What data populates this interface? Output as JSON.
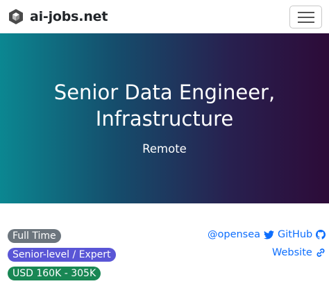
{
  "navbar": {
    "brand": "ai-jobs.net",
    "logo_icon": "hexagon-cube-logo-icon",
    "menu_icon": "hamburger-menu-icon"
  },
  "hero": {
    "title_line1": "Senior Data Engineer,",
    "title_line2": "Infrastructure",
    "location": "Remote",
    "gradient_colors": [
      "#0b8791",
      "#2d0b38"
    ]
  },
  "details": {
    "employment_type": "Full Time",
    "level": "Senior-level / Expert",
    "salary": "USD 160K - 305K",
    "colors": {
      "employment_type": "#6c757d",
      "level": "#5a56d6",
      "salary": "#198754"
    }
  },
  "links": {
    "twitter": "@opensea",
    "twitter_icon": "twitter-icon",
    "github": "GitHub",
    "github_icon": "github-icon",
    "website": "Website",
    "website_icon": "link-icon",
    "color": "#0d6efd"
  }
}
